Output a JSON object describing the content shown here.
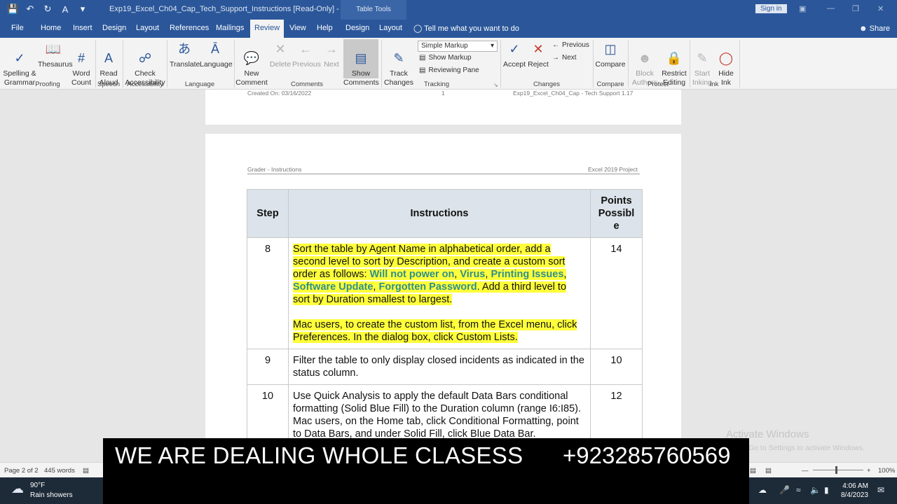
{
  "titlebar": {
    "doc_title": "Exp19_Excel_Ch04_Cap_Tech_Support_Instructions [Read-Only] - Word",
    "context_tab": "Table Tools",
    "sign_in": "Sign in"
  },
  "tabs": [
    {
      "label": "File"
    },
    {
      "label": "Home"
    },
    {
      "label": "Insert"
    },
    {
      "label": "Design"
    },
    {
      "label": "Layout"
    },
    {
      "label": "References"
    },
    {
      "label": "Mailings"
    },
    {
      "label": "Review"
    },
    {
      "label": "View"
    },
    {
      "label": "Help"
    },
    {
      "label": "Design"
    },
    {
      "label": "Layout"
    }
  ],
  "tell_me": "Tell me what you want to do",
  "share": "Share",
  "ribbon": {
    "spelling": "Spelling &\nGrammar",
    "thesaurus": "Thesaurus",
    "word_count": "Word\nCount",
    "read_aloud": "Read\nAloud",
    "check_accessibility": "Check\nAccessibility",
    "translate": "Translate",
    "language": "Language",
    "new_comment": "New\nComment",
    "delete": "Delete",
    "previous": "Previous",
    "next": "Next",
    "show_comments": "Show\nComments",
    "track_changes": "Track\nChanges",
    "simple_markup": "Simple Markup",
    "show_markup": "Show Markup",
    "reviewing_pane": "Reviewing Pane",
    "accept": "Accept",
    "reject": "Reject",
    "changes_previous": "Previous",
    "changes_next": "Next",
    "compare": "Compare",
    "block_authors": "Block\nAuthors",
    "restrict_editing": "Restrict\nEditing",
    "start_inking": "Start\nInking",
    "hide_ink": "Hide\nInk",
    "groups": {
      "proofing": "Proofing",
      "speech": "Speech",
      "accessibility": "Accessibility",
      "language": "Language",
      "comments": "Comments",
      "tracking": "Tracking",
      "changes": "Changes",
      "compare": "Compare",
      "protect": "Protect",
      "ink": "Ink"
    }
  },
  "page1_footer": {
    "created": "Created On: 03/16/2022",
    "page_num": "1",
    "file": "Exp19_Excel_Ch04_Cap - Tech Support 1.17"
  },
  "page2_header": {
    "left": "Grader - Instructions",
    "right": "Excel 2019 Project"
  },
  "table": {
    "headers": {
      "step": "Step",
      "instructions": "Instructions",
      "points": "Points\nPossibl\ne"
    },
    "rows": [
      {
        "step": "8",
        "text_a": "Sort the table by Agent Name in alphabetical order, add a second level to sort by Description, and create a custom sort order as follows: ",
        "kw1": "Will not power on",
        "sep1": ", ",
        "kw2": "Virus",
        "sep2": ", ",
        "kw3": "Printing Issues",
        "sep3": ", ",
        "kw4": "Software Update",
        "sep4": ", ",
        "kw5": "Forgotten Password",
        "text_b": ". Add a third level to sort by Duration smallest to largest.",
        "text_c": "Mac users, to create the custom list, from the Excel menu, click Preferences. In the dialog box, click Custom Lists.",
        "points": "14"
      },
      {
        "step": "9",
        "text": "Filter the table to only display closed incidents as indicated in the status column.",
        "points": "10"
      },
      {
        "step": "10",
        "text": "Use Quick Analysis to apply the default Data Bars conditional formatting (Solid Blue Fill) to the Duration column (range I6:I85). Mac users, on the Home tab, click Conditional Formatting, point to Data Bars, and under Solid Fill, click Blue Data Bar.",
        "points": "12"
      }
    ]
  },
  "statusbar": {
    "page": "Page 2 of 2",
    "words": "445 words",
    "zoom": "100%"
  },
  "watermark": {
    "title": "Activate Windows",
    "sub": "Go to Settings to activate Windows."
  },
  "taskbar": {
    "temp": "90°F",
    "weather": "Rain showers",
    "time": "4:06 AM",
    "date": "8/4/2023"
  },
  "banner": {
    "text": "WE ARE DEALING WHOLE CLASESS",
    "phone": "+923285760569"
  }
}
